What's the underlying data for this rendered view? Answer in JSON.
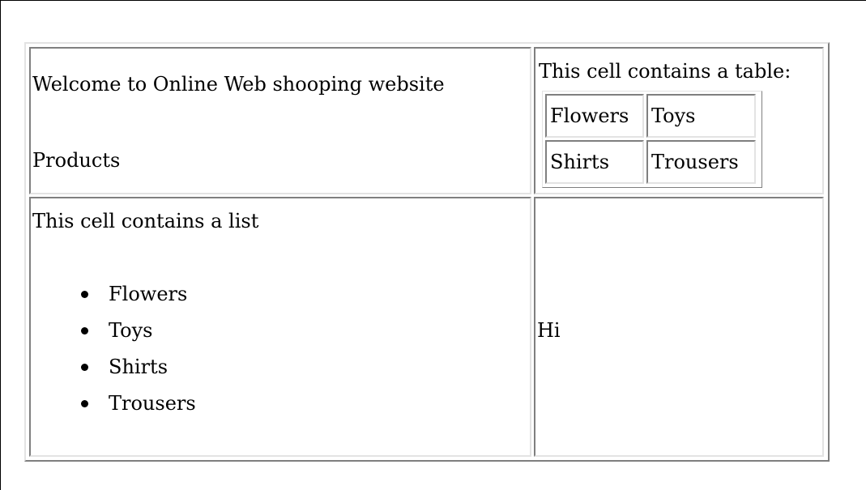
{
  "welcome_cell": {
    "heading": "Welcome to Online Web shooping website",
    "subheading": "Products"
  },
  "nested_table_cell": {
    "caption": "This cell contains a table:",
    "rows": [
      [
        "Flowers",
        "Toys"
      ],
      [
        "Shirts",
        "Trousers"
      ]
    ]
  },
  "list_cell": {
    "caption": "This cell contains a list",
    "items": [
      "Flowers",
      "Toys",
      "Shirts",
      "Trousers"
    ]
  },
  "hi_cell": {
    "text": "Hi"
  }
}
